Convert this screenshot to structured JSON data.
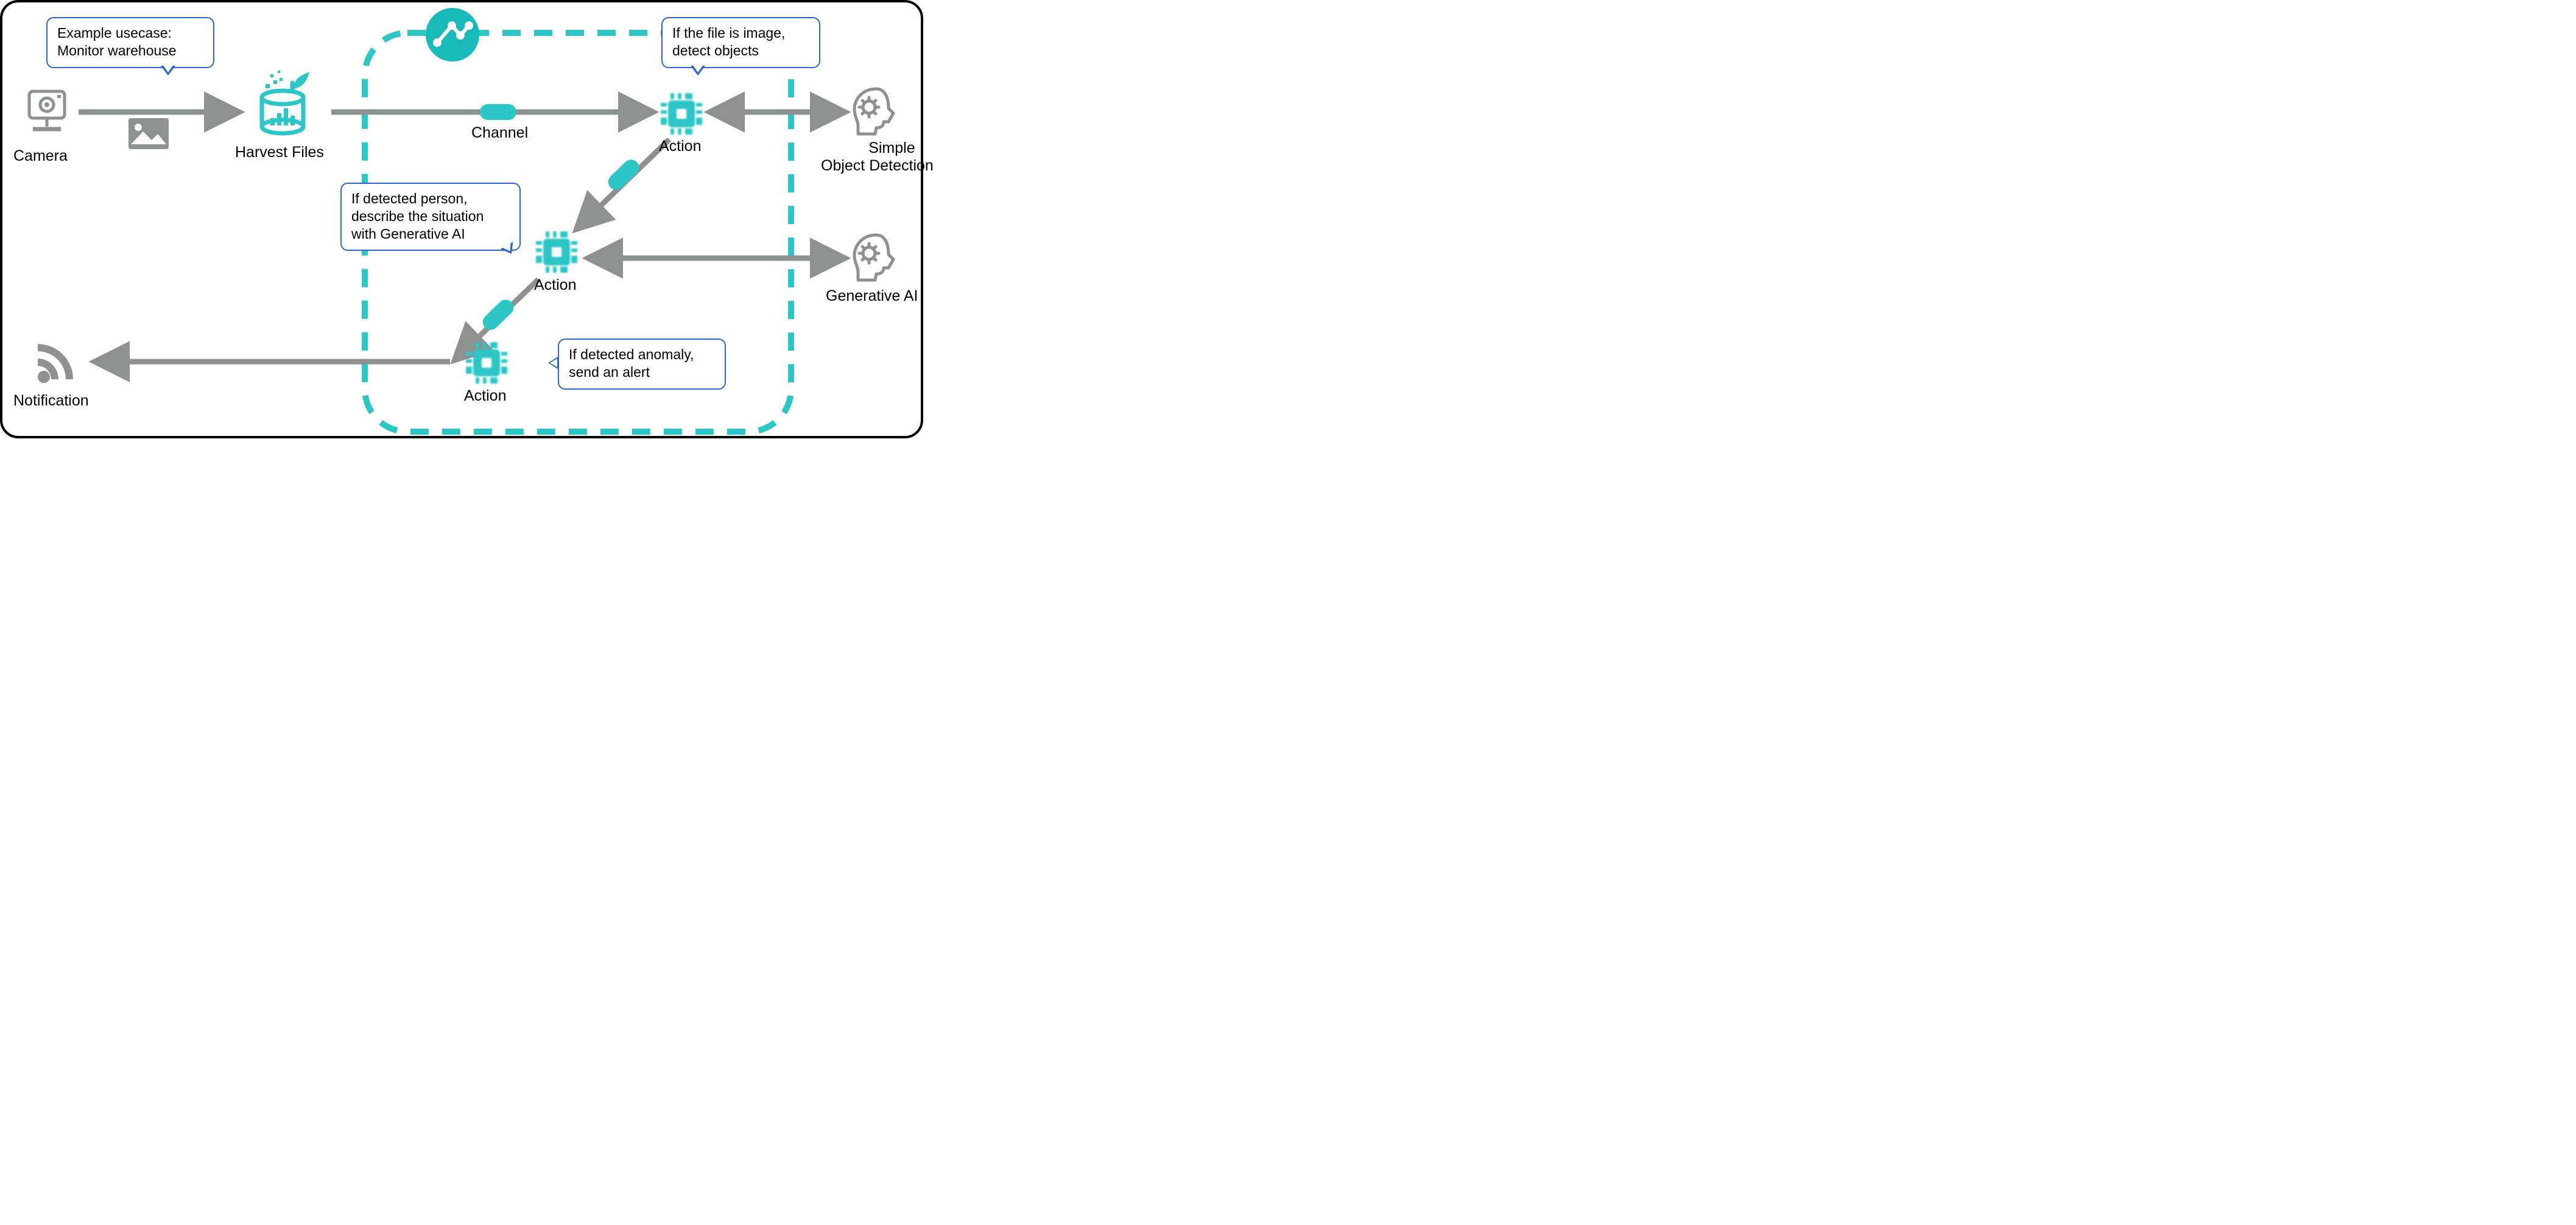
{
  "nodes": {
    "camera": {
      "label": "Camera"
    },
    "harvest": {
      "label": "Harvest Files"
    },
    "channel": {
      "label": "Channel"
    },
    "action1": {
      "label": "Action"
    },
    "action2": {
      "label": "Action"
    },
    "action3": {
      "label": "Action"
    },
    "simple_detect": {
      "label_line1": "Simple",
      "label_line2": "Object Detection"
    },
    "gen_ai": {
      "label": "Generative AI"
    },
    "notification": {
      "label": "Notification"
    }
  },
  "callouts": {
    "usecase": {
      "line1": "Example usecase:",
      "line2": "Monitor warehouse"
    },
    "detect_objects": {
      "line1": "If the file is image,",
      "line2": "detect objects"
    },
    "describe": {
      "line1": "If detected person,",
      "line2": "describe the situation",
      "line3": "with Generative AI"
    },
    "anomaly": {
      "line1": "If detected anomaly,",
      "line2": "send an alert"
    }
  },
  "colors": {
    "teal": "#2cc6c7",
    "grey": "#8d918f",
    "callout_border": "#2b67c9"
  }
}
